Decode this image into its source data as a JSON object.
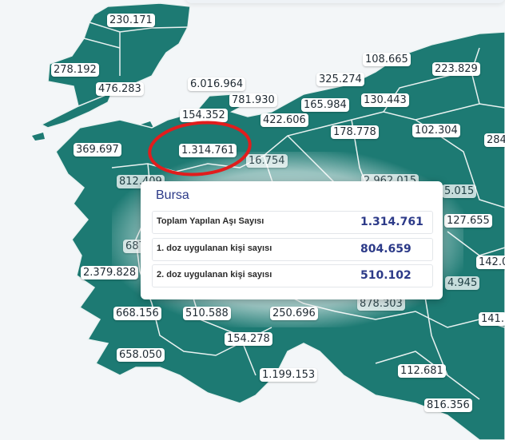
{
  "colors": {
    "map_fill": "#1d7a73",
    "background": "#f3f6f8",
    "border": "#e9f2f1",
    "highlight": "#e11d1d",
    "tooltip_text": "#2c3a88"
  },
  "map": {
    "labels": [
      {
        "id": "l1",
        "text": "230.171"
      },
      {
        "id": "l2",
        "text": "278.192"
      },
      {
        "id": "l3",
        "text": "476.283"
      },
      {
        "id": "l4",
        "text": "6.016.964"
      },
      {
        "id": "l5",
        "text": "781.930"
      },
      {
        "id": "l6",
        "text": "108.665"
      },
      {
        "id": "l7",
        "text": "223.829"
      },
      {
        "id": "l8",
        "text": "325.274"
      },
      {
        "id": "l9",
        "text": "154.352"
      },
      {
        "id": "l10",
        "text": "165.984"
      },
      {
        "id": "l11",
        "text": "130.443"
      },
      {
        "id": "l12",
        "text": "422.606"
      },
      {
        "id": "l13",
        "text": "178.778"
      },
      {
        "id": "l14",
        "text": "102.304"
      },
      {
        "id": "l15",
        "text": "284"
      },
      {
        "id": "l16",
        "text": "369.697"
      },
      {
        "id": "l17",
        "text": "1.314.761"
      },
      {
        "id": "l18",
        "text": "16.754"
      },
      {
        "id": "l19",
        "text": "812.409"
      },
      {
        "id": "l20",
        "text": "2.962.015"
      },
      {
        "id": "l21",
        "text": "5.015"
      },
      {
        "id": "l22",
        "text": "127.655"
      },
      {
        "id": "l23",
        "text": "687"
      },
      {
        "id": "l24",
        "text": "142.0"
      },
      {
        "id": "l25",
        "text": "2.379.828"
      },
      {
        "id": "l26",
        "text": "4.945"
      },
      {
        "id": "l27",
        "text": "878.303"
      },
      {
        "id": "l28",
        "text": "668.156"
      },
      {
        "id": "l29",
        "text": "510.588"
      },
      {
        "id": "l30",
        "text": "250.696"
      },
      {
        "id": "l31",
        "text": "141."
      },
      {
        "id": "l32",
        "text": "154.278"
      },
      {
        "id": "l33",
        "text": "658.050"
      },
      {
        "id": "l34",
        "text": "1.199.153"
      },
      {
        "id": "l35",
        "text": "112.681"
      },
      {
        "id": "l36",
        "text": "816.356"
      }
    ]
  },
  "tooltip": {
    "title": "Bursa",
    "rows": [
      {
        "label": "Toplam Yapılan Aşı Sayısı",
        "value": "1.314.761"
      },
      {
        "label": "1. doz uygulanan kişi sayısı",
        "value": "804.659"
      },
      {
        "label": "2. doz uygulanan kişi sayısı",
        "value": "510.102"
      }
    ]
  }
}
